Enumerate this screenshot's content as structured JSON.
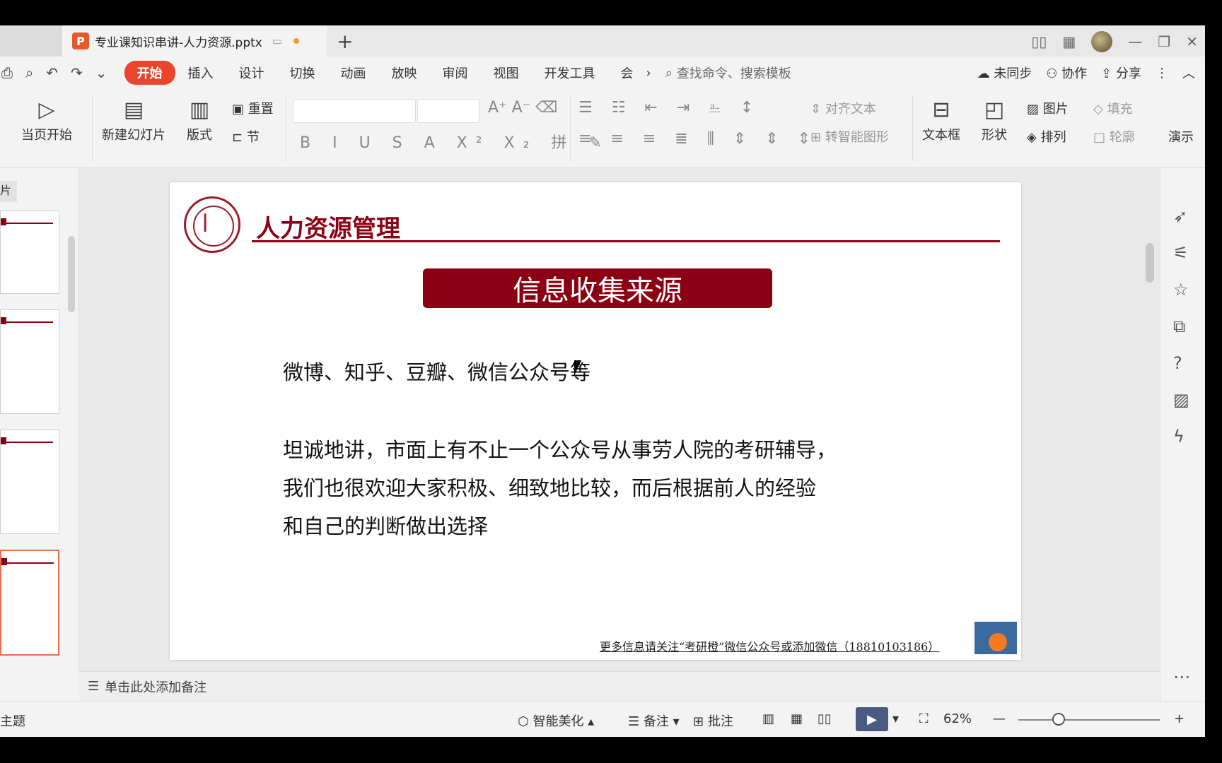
{
  "titlebar": {
    "doc_title": "专业课知识串讲-人力资源.pptx",
    "new_tab": "+"
  },
  "menubar": {
    "items": [
      "开始",
      "插入",
      "设计",
      "切换",
      "动画",
      "放映",
      "审阅",
      "视图",
      "开发工具",
      "会"
    ],
    "active": "开始",
    "search_placeholder": "查找命令、搜索模板",
    "sync": "未同步",
    "collab": "协作",
    "share": "分享"
  },
  "ribbon": {
    "play_from_current": "当页开始",
    "new_slide": "新建幻灯片",
    "layout": "版式",
    "reset": "重置",
    "section": "节",
    "align_text": "对齐文本",
    "smart_shape": "转智能图形",
    "textbox": "文本框",
    "shape": "形状",
    "picture": "图片",
    "fill": "填充",
    "arrange": "排列",
    "outline": "轮廓",
    "present": "演示"
  },
  "left_panel": {
    "tab_label": "片"
  },
  "slide": {
    "header": "人力资源管理",
    "banner": "信息收集来源",
    "line1": "微博、知乎、豆瓣、微信公众号等",
    "para": [
      "坦诚地讲，市面上有不止一个公众号从事劳人院的考研辅导，",
      "我们也很欢迎大家积极、细致地比较，而后根据前人的经验",
      "和自己的判断做出选择"
    ],
    "footer": "更多信息请关注“考研橙”微信公众号或添加微信（18810103186）"
  },
  "notes": {
    "placeholder": "单击此处添加备注"
  },
  "statusbar": {
    "theme": "主题",
    "smart_beautify": "智能美化",
    "notes": "备注",
    "comments": "批注",
    "zoom": "62%"
  }
}
